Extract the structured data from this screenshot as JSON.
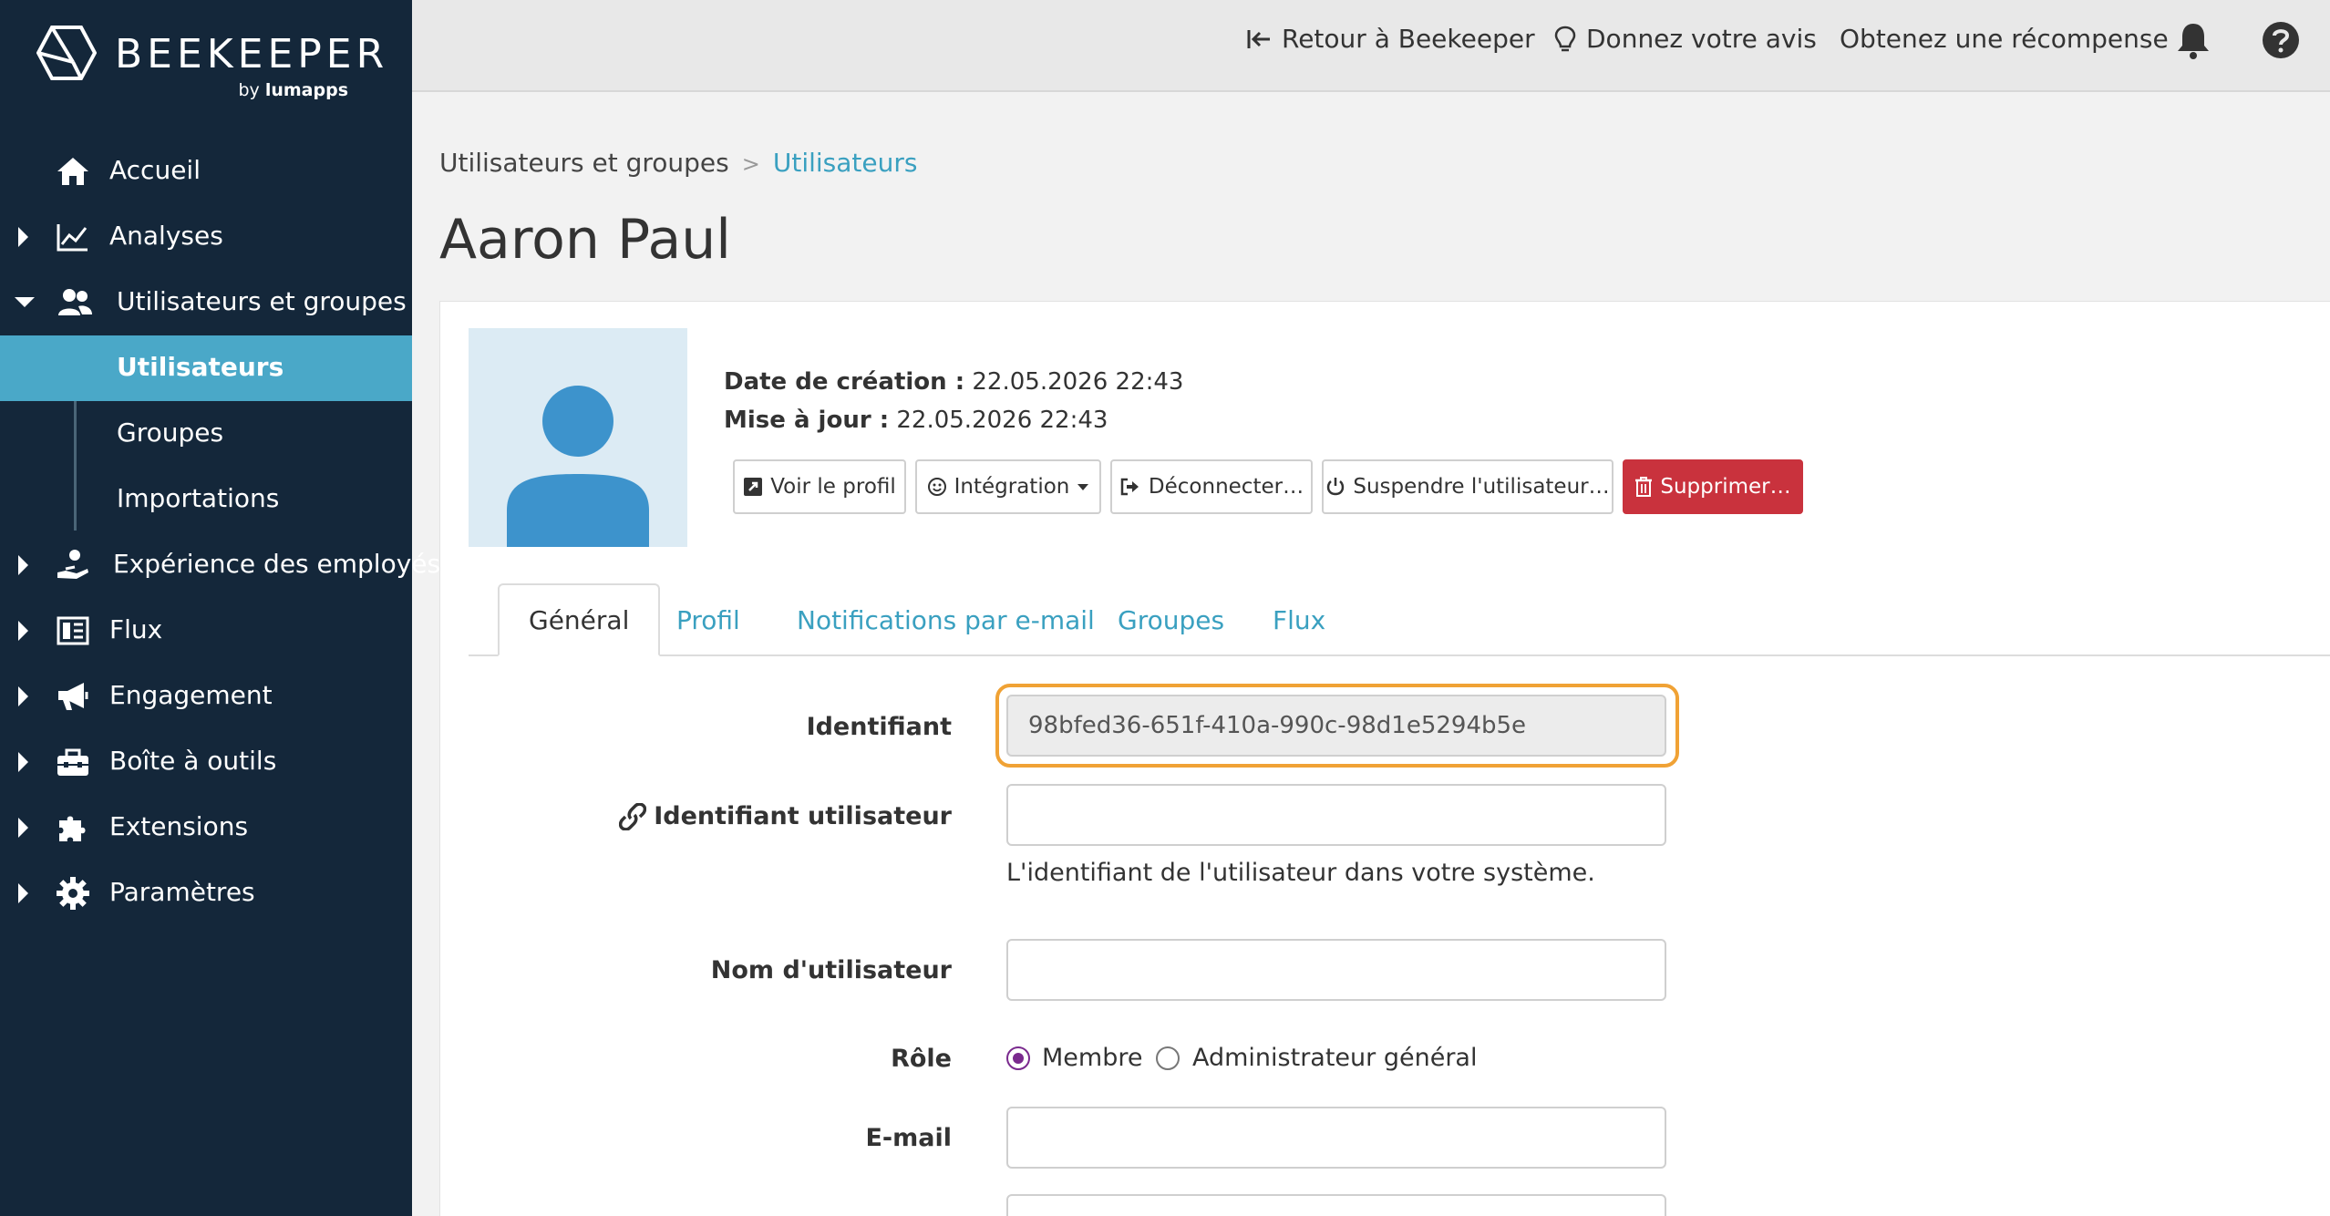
{
  "brand": {
    "name": "BEEKEEPER",
    "by_prefix": "by",
    "by_name": "lumapps"
  },
  "sidebar": {
    "items": [
      {
        "label": "Accueil"
      },
      {
        "label": "Analyses"
      },
      {
        "label": "Utilisateurs et groupes"
      },
      {
        "label": "Expérience des employés"
      },
      {
        "label": "Flux"
      },
      {
        "label": "Engagement"
      },
      {
        "label": "Boîte à outils"
      },
      {
        "label": "Extensions"
      },
      {
        "label": "Paramètres"
      }
    ],
    "subitems": [
      {
        "label": "Utilisateurs"
      },
      {
        "label": "Groupes"
      },
      {
        "label": "Importations"
      }
    ]
  },
  "topbar": {
    "back": "Retour à Beekeeper",
    "feedback": "Donnez votre avis",
    "reward": "Obtenez une récompense"
  },
  "breadcrumb": {
    "parent": "Utilisateurs et groupes",
    "sep": ">",
    "current": "Utilisateurs"
  },
  "page": {
    "title": "Aaron Paul"
  },
  "meta": {
    "created_label": "Date de création :",
    "created_value": "22.05.2026 22:43",
    "updated_label": "Mise à jour :",
    "updated_value": "22.05.2026 22:43"
  },
  "actions": {
    "view_profile": "Voir le profil",
    "integration": "Intégration",
    "logout": "Déconnecter…",
    "suspend": "Suspendre l'utilisateur…",
    "delete": "Supprimer…"
  },
  "tabs": [
    {
      "label": "Général"
    },
    {
      "label": "Profil"
    },
    {
      "label": "Notifications par e-mail"
    },
    {
      "label": "Groupes"
    },
    {
      "label": "Flux"
    }
  ],
  "form": {
    "identifier_label": "Identifiant",
    "identifier_value": "98bfed36-651f-410a-990c-98d1e5294b5e",
    "user_identifier_label": "Identifiant utilisateur",
    "user_identifier_value": "",
    "user_identifier_help": "L'identifiant de l'utilisateur dans votre système.",
    "username_label": "Nom d'utilisateur",
    "username_value": "",
    "role_label": "Rôle",
    "role_options": [
      "Membre",
      "Administrateur général"
    ],
    "role_selected": "Membre",
    "email_label": "E-mail",
    "email_value": ""
  },
  "colors": {
    "sidebar_bg": "#14273a",
    "accent": "#4aa8c8",
    "link": "#3aa0c0",
    "danger": "#c9323d",
    "highlight": "#f0a235",
    "radio": "#7a2a8e"
  }
}
